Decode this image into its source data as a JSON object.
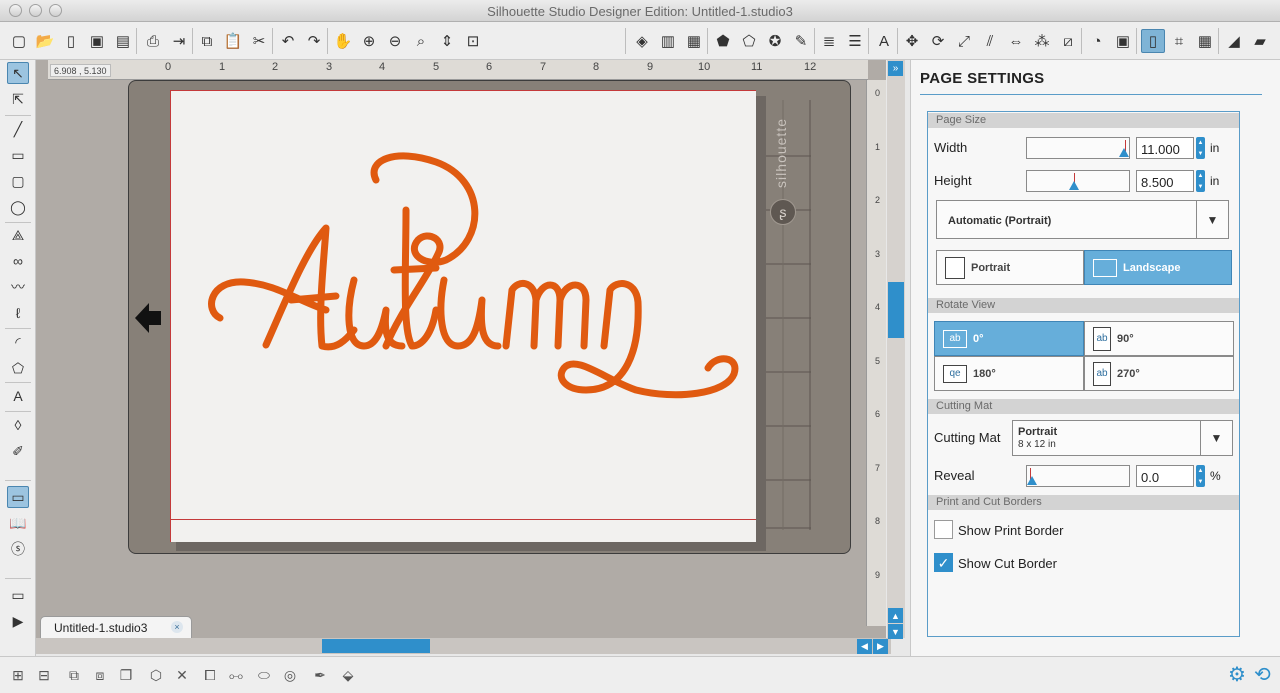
{
  "window": {
    "title": "Silhouette Studio Designer Edition: Untitled-1.studio3"
  },
  "canvas": {
    "coordinates": "6.908 , 5.130",
    "ruler_top": [
      "0",
      "1",
      "2",
      "3",
      "4",
      "5",
      "6",
      "7",
      "8",
      "9",
      "10",
      "11",
      "12"
    ],
    "ruler_side": [
      "0",
      "1",
      "2",
      "3",
      "4",
      "5",
      "6",
      "7",
      "8",
      "9"
    ],
    "mat_brand": "silhouette",
    "design_text": "Autumn",
    "design_color": "#e05a10",
    "doc_tab": "Untitled-1.studio3"
  },
  "panel": {
    "title": "PAGE SETTINGS",
    "page_size": {
      "section": "Page Size",
      "width_label": "Width",
      "width_value": "11.000",
      "width_unit": "in",
      "height_label": "Height",
      "height_value": "8.500",
      "height_unit": "in",
      "size_preset": "Automatic (Portrait)",
      "orientation_portrait": "Portrait",
      "orientation_landscape": "Landscape",
      "orientation_selected": "Landscape"
    },
    "rotate_view": {
      "section": "Rotate View",
      "options": [
        "0°",
        "90°",
        "180°",
        "270°"
      ],
      "selected": "0°"
    },
    "cutting_mat": {
      "section": "Cutting Mat",
      "label": "Cutting Mat",
      "selected_name": "Portrait",
      "selected_size": "8 x 12 in",
      "reveal_label": "Reveal",
      "reveal_value": "0.0",
      "reveal_unit": "%"
    },
    "borders": {
      "section": "Print and Cut Borders",
      "show_print_border": "Show Print Border",
      "show_print_border_checked": false,
      "show_cut_border": "Show Cut Border",
      "show_cut_border_checked": true
    }
  },
  "colors": {
    "accent": "#2f8fcb",
    "selected": "#66aeda",
    "cut_line": "#c43a3a"
  }
}
